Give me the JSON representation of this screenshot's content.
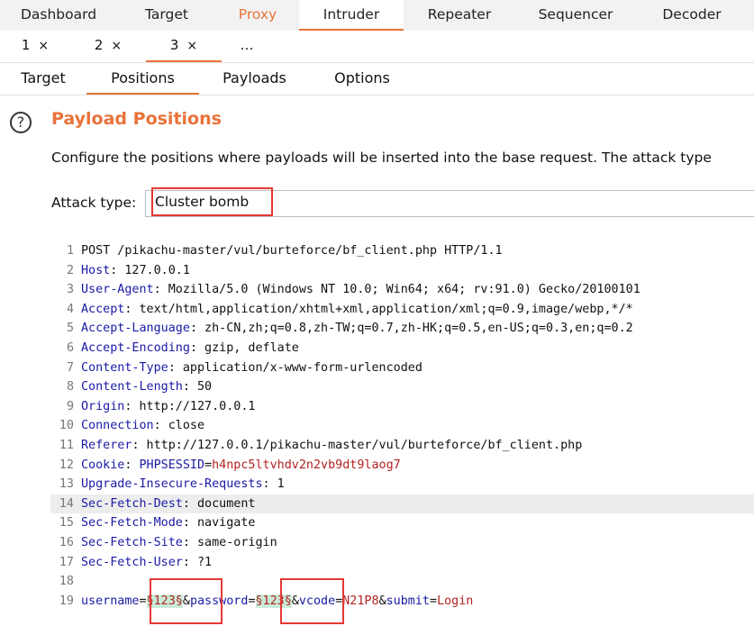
{
  "top_tabs": [
    "Dashboard",
    "Target",
    "Proxy",
    "Intruder",
    "Repeater",
    "Sequencer",
    "Decoder"
  ],
  "attack_tabs": [
    {
      "label": "1",
      "close": "×"
    },
    {
      "label": "2",
      "close": "×"
    },
    {
      "label": "3",
      "close": "×"
    },
    {
      "label": "…",
      "close": ""
    }
  ],
  "inner_tabs": [
    "Target",
    "Positions",
    "Payloads",
    "Options"
  ],
  "section": {
    "help_glyph": "?",
    "title": "Payload Positions",
    "description": "Configure the positions where payloads will be inserted into the base request. The attack type"
  },
  "attack_type": {
    "label": "Attack type:",
    "value": "Cluster bomb"
  },
  "request": {
    "line1": {
      "num": "1",
      "text": "POST /pikachu-master/vul/burteforce/bf_client.php HTTP/1.1"
    },
    "headers": [
      {
        "num": "2",
        "key": "Host",
        "value": ": 127.0.0.1"
      },
      {
        "num": "3",
        "key": "User-Agent",
        "value": ": Mozilla/5.0 (Windows NT 10.0; Win64; x64; rv:91.0) Gecko/20100101"
      },
      {
        "num": "4",
        "key": "Accept",
        "value": ": text/html,application/xhtml+xml,application/xml;q=0.9,image/webp,*/*"
      },
      {
        "num": "5",
        "key": "Accept-Language",
        "value": ": zh-CN,zh;q=0.8,zh-TW;q=0.7,zh-HK;q=0.5,en-US;q=0.3,en;q=0.2"
      },
      {
        "num": "6",
        "key": "Accept-Encoding",
        "value": ": gzip, deflate"
      },
      {
        "num": "7",
        "key": "Content-Type",
        "value": ": application/x-www-form-urlencoded"
      },
      {
        "num": "8",
        "key": "Content-Length",
        "value": ": 50"
      },
      {
        "num": "9",
        "key": "Origin",
        "value": ": http://127.0.0.1"
      },
      {
        "num": "10",
        "key": "Connection",
        "value": ": close"
      },
      {
        "num": "11",
        "key": "Referer",
        "value": ": http://127.0.0.1/pikachu-master/vul/burteforce/bf_client.php"
      }
    ],
    "cookie": {
      "num": "12",
      "key": "Cookie",
      "sep": ": ",
      "name": "PHPSESSID",
      "eq": "=",
      "value": "h4npc5ltvhdv2n2vb9dt9laog7"
    },
    "headers2": [
      {
        "num": "13",
        "key": "Upgrade-Insecure-Requests",
        "value": ": 1"
      },
      {
        "num": "14",
        "key": "Sec-Fetch-Dest",
        "value": ": document"
      },
      {
        "num": "15",
        "key": "Sec-Fetch-Mode",
        "value": ": navigate"
      },
      {
        "num": "16",
        "key": "Sec-Fetch-Site",
        "value": ": same-origin"
      },
      {
        "num": "17",
        "key": "Sec-Fetch-User",
        "value": ": ?1"
      }
    ],
    "empty_line": {
      "num": "18"
    },
    "body": {
      "num": "19",
      "k1": "username",
      "eq1": "=",
      "p1": "§123§",
      "amp1": "&",
      "k2": "password",
      "eq2": "=",
      "p2": "§123§",
      "amp2": "&",
      "k3": "vcode",
      "eq3": "=",
      "v3": "N21P8",
      "amp3": "&",
      "k4": "submit",
      "eq4": "=",
      "v4": "Login"
    }
  }
}
